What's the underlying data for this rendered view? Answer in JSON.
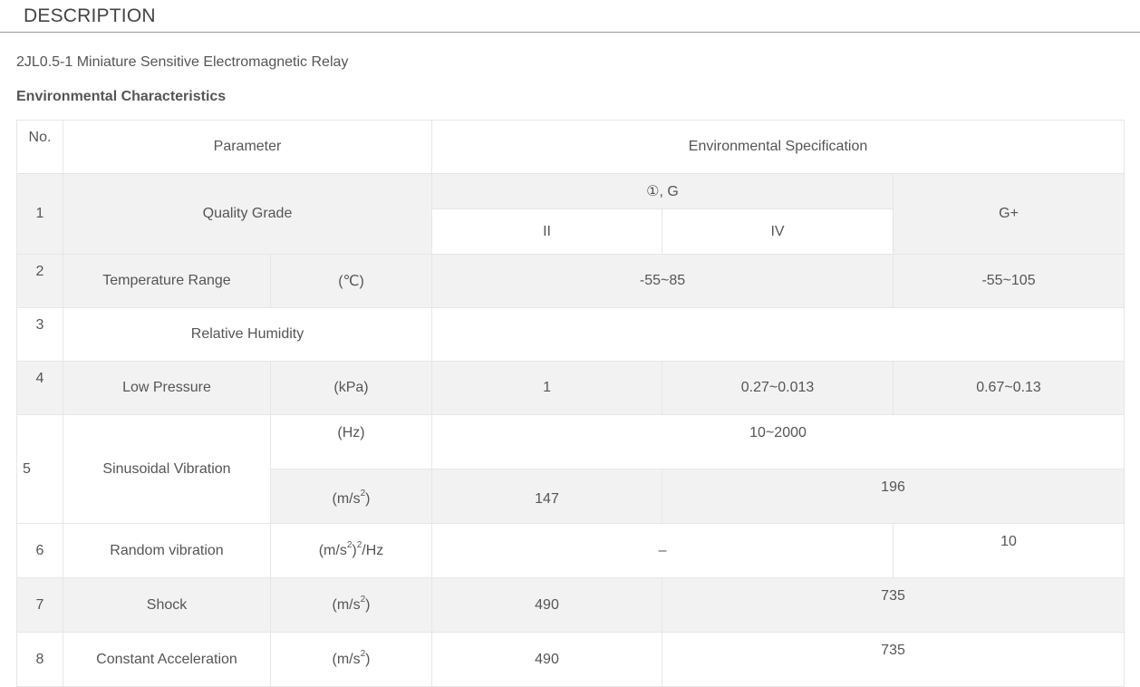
{
  "header": {
    "title": "DESCRIPTION"
  },
  "product": {
    "title": "2JL0.5-1 Miniature Sensitive Electromagnetic Relay"
  },
  "section": {
    "title": "Environmental Characteristics"
  },
  "table": {
    "headers": {
      "no": "No.",
      "parameter": "Parameter",
      "spec": "Environmental Specification"
    },
    "grade_header": {
      "jg": "①, G",
      "col_ii": "II",
      "col_iv": "IV",
      "g_plus": "G+"
    },
    "rows": [
      {
        "no": "1",
        "parameter": "Quality Grade"
      },
      {
        "no": "2",
        "parameter": "Temperature Range",
        "unit": "(℃)",
        "v_j": "-55~85",
        "v_g": "-55~105"
      },
      {
        "no": "3",
        "parameter": "Relative Humidity"
      },
      {
        "no": "4",
        "parameter": "Low Pressure",
        "unit": "(kPa)",
        "v_ii": "1",
        "v_iv": "0.27~0.013",
        "v_g": "0.67~0.13"
      },
      {
        "no": "5",
        "parameter": "Sinusoidal Vibration",
        "unit_a": "(Hz)",
        "v_a": "10~2000",
        "unit_b_pre": "(m/s",
        "unit_b_sup": "2",
        "unit_b_post": ")",
        "v_b_ii": "147",
        "v_b_rest": "196"
      },
      {
        "no": "6",
        "parameter": "Random vibration",
        "unit_pre": "(m/s",
        "unit_sup1": "2",
        "unit_mid": ")",
        "unit_sup2": "2",
        "unit_post": "/Hz",
        "v_j": "–",
        "v_g": "10"
      },
      {
        "no": "7",
        "parameter": "Shock",
        "unit_pre": "(m/s",
        "unit_sup": "2",
        "unit_post": ")",
        "v_ii": "490",
        "v_rest": "735"
      },
      {
        "no": "8",
        "parameter": "Constant Acceleration",
        "unit_pre": "(m/s",
        "unit_sup": "2",
        "unit_post": ")",
        "v_ii": "490",
        "v_rest": "735"
      }
    ]
  }
}
